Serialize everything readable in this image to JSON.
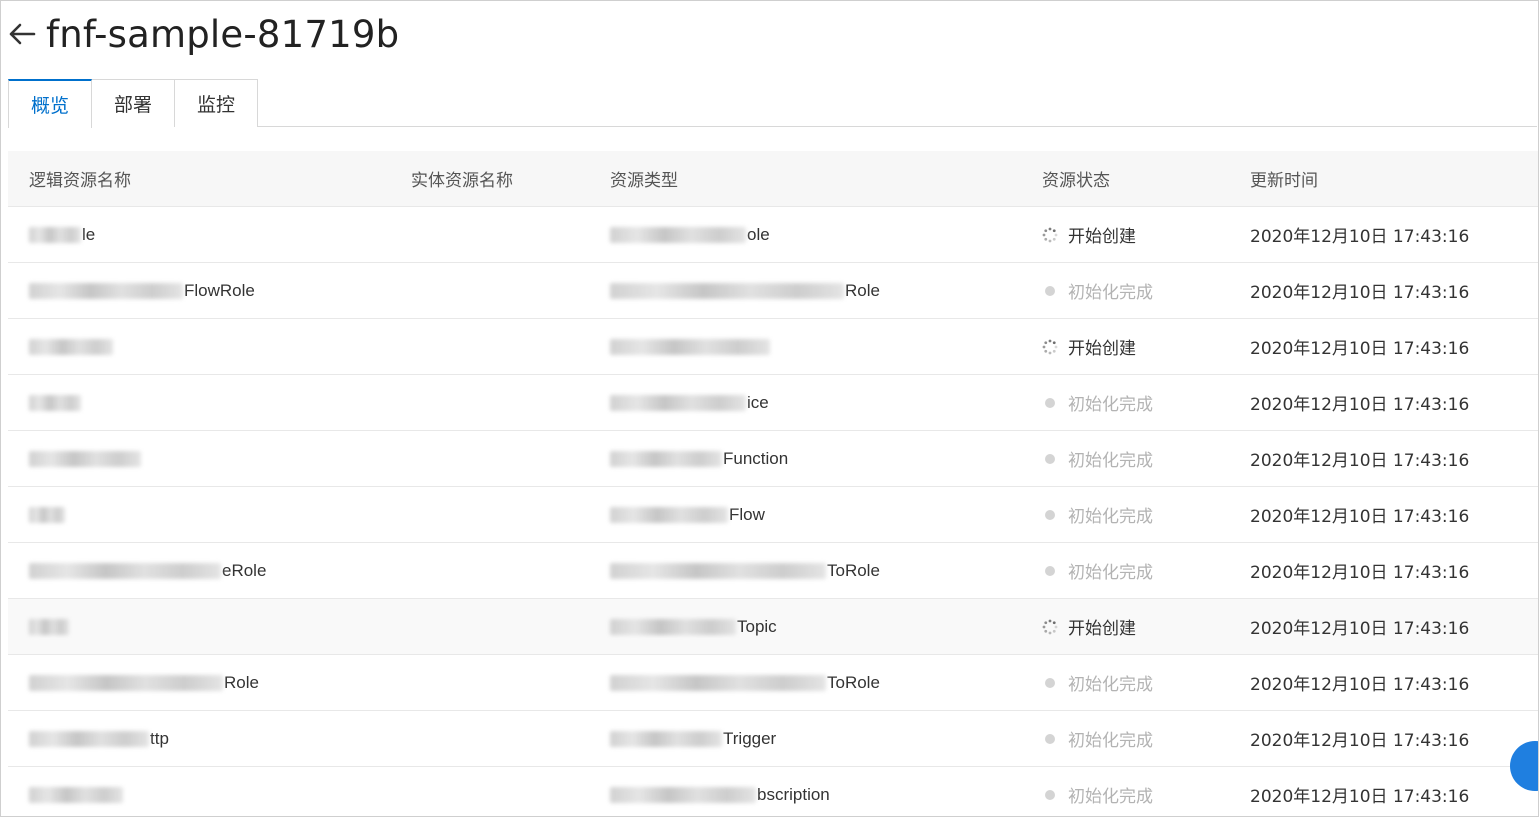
{
  "header": {
    "back_icon": "arrow-left-icon",
    "title": "fnf-sample-81719b"
  },
  "tabs": [
    {
      "label": "概览",
      "active": true
    },
    {
      "label": "部署",
      "active": false
    },
    {
      "label": "监控",
      "active": false
    }
  ],
  "table": {
    "columns": [
      "逻辑资源名称",
      "实体资源名称",
      "资源类型",
      "资源状态",
      "更新时间"
    ],
    "rows": [
      {
        "logical_suffix": "le",
        "logical_blur": 52,
        "type_suffix": "ole",
        "type_blur": 136,
        "status": "开始创建",
        "status_kind": "creating",
        "time": "2020年12月10日 17:43:16"
      },
      {
        "logical_suffix": "FlowRole",
        "logical_blur": 154,
        "type_suffix": "Role",
        "type_blur": 234,
        "status": "初始化完成",
        "status_kind": "done",
        "time": "2020年12月10日 17:43:16"
      },
      {
        "logical_suffix": "",
        "logical_blur": 84,
        "type_suffix": "",
        "type_blur": 160,
        "status": "开始创建",
        "status_kind": "creating",
        "time": "2020年12月10日 17:43:16"
      },
      {
        "logical_suffix": "",
        "logical_blur": 52,
        "type_suffix": "ice",
        "type_blur": 136,
        "status": "初始化完成",
        "status_kind": "done",
        "time": "2020年12月10日 17:43:16"
      },
      {
        "logical_suffix": "",
        "logical_blur": 112,
        "type_suffix": "Function",
        "type_blur": 112,
        "status": "初始化完成",
        "status_kind": "done",
        "time": "2020年12月10日 17:43:16"
      },
      {
        "logical_suffix": "",
        "logical_blur": 36,
        "type_suffix": "Flow",
        "type_blur": 118,
        "status": "初始化完成",
        "status_kind": "done",
        "time": "2020年12月10日 17:43:16"
      },
      {
        "logical_suffix": "eRole",
        "logical_blur": 192,
        "type_suffix": "ToRole",
        "type_blur": 216,
        "status": "初始化完成",
        "status_kind": "done",
        "time": "2020年12月10日 17:43:16"
      },
      {
        "logical_suffix": "",
        "logical_blur": 40,
        "type_suffix": "Topic",
        "type_blur": 126,
        "status": "开始创建",
        "status_kind": "creating",
        "time": "2020年12月10日 17:43:16",
        "hover": true
      },
      {
        "logical_suffix": "Role",
        "logical_blur": 194,
        "type_suffix": "ToRole",
        "type_blur": 216,
        "status": "初始化完成",
        "status_kind": "done",
        "time": "2020年12月10日 17:43:16"
      },
      {
        "logical_suffix": "ttp",
        "logical_blur": 120,
        "type_suffix": "Trigger",
        "type_blur": 112,
        "status": "初始化完成",
        "status_kind": "done",
        "time": "2020年12月10日 17:43:16"
      },
      {
        "logical_suffix": "",
        "logical_blur": 94,
        "type_suffix": "bscription",
        "type_blur": 146,
        "status": "初始化完成",
        "status_kind": "done",
        "time": "2020年12月10日 17:43:16"
      }
    ]
  },
  "icons": {
    "creating": "spinner-icon",
    "done": "status-dot-icon"
  },
  "colors": {
    "accent": "#0070cc",
    "done_text": "#b3b3b3",
    "float_button": "#1f7fe0"
  }
}
